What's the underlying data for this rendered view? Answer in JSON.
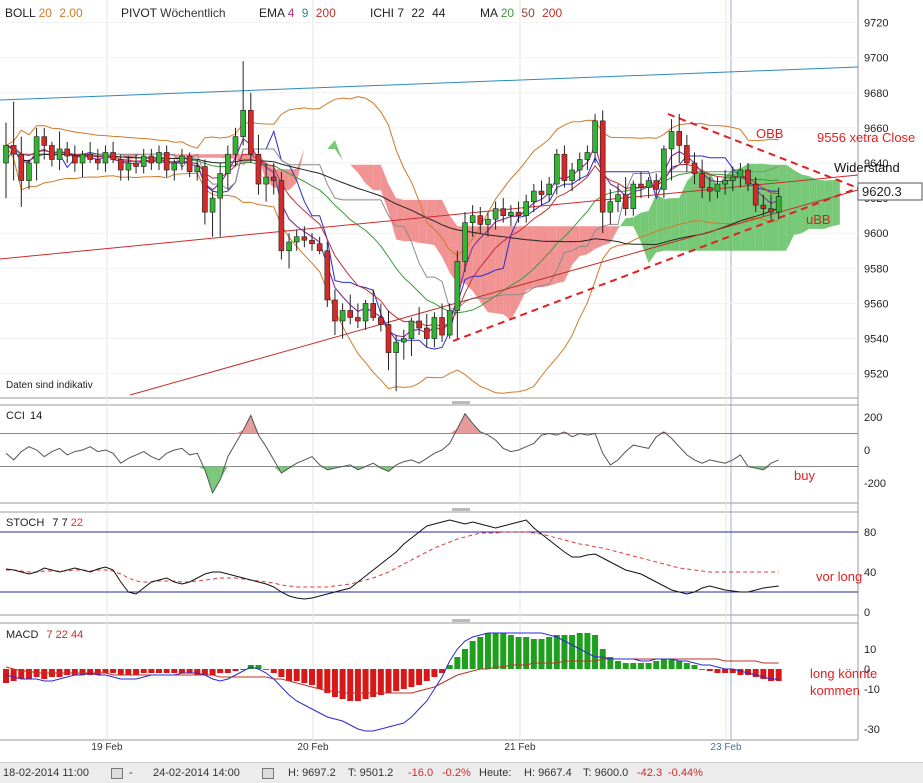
{
  "toolbar": {
    "items": [
      {
        "name": "BOLL",
        "params": [
          {
            "t": "20",
            "c": "#d07a2a"
          },
          {
            "t": "2.00",
            "c": "#d07a2a"
          }
        ]
      },
      {
        "name": "PIVOT",
        "params": [
          {
            "t": "Wöchentlich",
            "c": "#333333"
          }
        ]
      },
      {
        "name": "EMA",
        "params": [
          {
            "t": "4",
            "c": "#b0307f"
          },
          {
            "t": "9",
            "c": "#2a8a8a"
          },
          {
            "t": "200",
            "c": "#c0302a"
          }
        ]
      },
      {
        "name": "ICHI",
        "params": [
          {
            "t": "7",
            "c": "#333333"
          },
          {
            "t": "22",
            "c": "#333333"
          },
          {
            "t": "44",
            "c": "#333333"
          }
        ]
      },
      {
        "name": "MA",
        "params": [
          {
            "t": "20",
            "c": "#3a9a3a"
          },
          {
            "t": "50",
            "c": "#9a4040"
          },
          {
            "t": "200",
            "c": "#c0302a"
          }
        ]
      }
    ]
  },
  "indicators": {
    "cci": {
      "name": "CCI",
      "params": [
        "14"
      ]
    },
    "stoch": {
      "name": "STOCH",
      "params": [
        "7",
        "7",
        "22"
      ]
    },
    "macd": {
      "name": "MACD",
      "params": [
        "7",
        "22",
        "44"
      ]
    }
  },
  "chart_data": {
    "type": "candlestick",
    "disclaimer": "Daten sind indikativ",
    "price_axis": {
      "ticks": [
        9720,
        9700,
        9680,
        9660,
        9640,
        9620,
        9600,
        9580,
        9560,
        9540,
        9520
      ],
      "min": 9505,
      "max": 9730
    },
    "last_price": "9620.3",
    "dates": [
      "19 Feb",
      "20 Feb",
      "21 Feb",
      "23 Feb"
    ],
    "candles": [
      [
        9640,
        9663,
        9620,
        9650
      ],
      [
        9650,
        9675,
        9630,
        9645
      ],
      [
        9645,
        9655,
        9615,
        9630
      ],
      [
        9630,
        9642,
        9625,
        9640
      ],
      [
        9640,
        9660,
        9630,
        9655
      ],
      [
        9655,
        9660,
        9642,
        9650
      ],
      [
        9650,
        9652,
        9638,
        9642
      ],
      [
        9642,
        9658,
        9636,
        9648
      ],
      [
        9648,
        9652,
        9640,
        9644
      ],
      [
        9644,
        9650,
        9635,
        9640
      ],
      [
        9640,
        9647,
        9632,
        9645
      ],
      [
        9645,
        9652,
        9640,
        9642
      ],
      [
        9642,
        9648,
        9636,
        9640
      ],
      [
        9640,
        9650,
        9635,
        9646
      ],
      [
        9646,
        9652,
        9640,
        9642
      ],
      [
        9642,
        9645,
        9630,
        9636
      ],
      [
        9636,
        9644,
        9630,
        9640
      ],
      [
        9640,
        9645,
        9634,
        9638
      ],
      [
        9638,
        9648,
        9634,
        9644
      ],
      [
        9644,
        9648,
        9636,
        9640
      ],
      [
        9640,
        9650,
        9636,
        9646
      ],
      [
        9646,
        9650,
        9632,
        9636
      ],
      [
        9636,
        9642,
        9630,
        9640
      ],
      [
        9640,
        9648,
        9636,
        9644
      ],
      [
        9644,
        9646,
        9632,
        9635
      ],
      [
        9635,
        9642,
        9630,
        9638
      ],
      [
        9638,
        9642,
        9605,
        9612
      ],
      [
        9612,
        9624,
        9598,
        9620
      ],
      [
        9620,
        9640,
        9598,
        9634
      ],
      [
        9634,
        9650,
        9625,
        9645
      ],
      [
        9645,
        9660,
        9638,
        9655
      ],
      [
        9655,
        9698,
        9650,
        9670
      ],
      [
        9670,
        9680,
        9640,
        9645
      ],
      [
        9645,
        9656,
        9622,
        9628
      ],
      [
        9628,
        9640,
        9618,
        9632
      ],
      [
        9632,
        9640,
        9622,
        9630
      ],
      [
        9630,
        9635,
        9585,
        9590
      ],
      [
        9590,
        9600,
        9580,
        9595
      ],
      [
        9595,
        9602,
        9590,
        9598
      ],
      [
        9598,
        9604,
        9592,
        9596
      ],
      [
        9596,
        9600,
        9590,
        9594
      ],
      [
        9594,
        9598,
        9588,
        9590
      ],
      [
        9590,
        9595,
        9558,
        9562
      ],
      [
        9562,
        9568,
        9542,
        9550
      ],
      [
        9550,
        9560,
        9540,
        9556
      ],
      [
        9556,
        9565,
        9548,
        9552
      ],
      [
        9552,
        9560,
        9546,
        9550
      ],
      [
        9550,
        9562,
        9545,
        9560
      ],
      [
        9560,
        9568,
        9550,
        9552
      ],
      [
        9552,
        9560,
        9544,
        9548
      ],
      [
        9548,
        9556,
        9522,
        9532
      ],
      [
        9532,
        9542,
        9510,
        9538
      ],
      [
        9538,
        9545,
        9528,
        9540
      ],
      [
        9540,
        9552,
        9530,
        9550
      ],
      [
        9550,
        9558,
        9542,
        9546
      ],
      [
        9546,
        9554,
        9535,
        9540
      ],
      [
        9540,
        9555,
        9535,
        9552
      ],
      [
        9552,
        9560,
        9538,
        9542
      ],
      [
        9542,
        9560,
        9540,
        9556
      ],
      [
        9556,
        9590,
        9540,
        9584
      ],
      [
        9584,
        9612,
        9578,
        9606
      ],
      [
        9606,
        9616,
        9598,
        9610
      ],
      [
        9610,
        9615,
        9600,
        9605
      ],
      [
        9605,
        9612,
        9598,
        9608
      ],
      [
        9608,
        9618,
        9602,
        9614
      ],
      [
        9614,
        9620,
        9606,
        9610
      ],
      [
        9610,
        9616,
        9604,
        9612
      ],
      [
        9612,
        9618,
        9606,
        9610
      ],
      [
        9610,
        9622,
        9606,
        9618
      ],
      [
        9618,
        9628,
        9612,
        9624
      ],
      [
        9624,
        9630,
        9616,
        9622
      ],
      [
        9622,
        9632,
        9618,
        9628
      ],
      [
        9628,
        9648,
        9622,
        9645
      ],
      [
        9645,
        9650,
        9626,
        9630
      ],
      [
        9630,
        9640,
        9624,
        9636
      ],
      [
        9636,
        9646,
        9630,
        9642
      ],
      [
        9642,
        9650,
        9636,
        9646
      ],
      [
        9646,
        9668,
        9640,
        9664
      ],
      [
        9664,
        9670,
        9600,
        9612
      ],
      [
        9612,
        9625,
        9605,
        9618
      ],
      [
        9618,
        9628,
        9612,
        9622
      ],
      [
        9622,
        9632,
        9610,
        9614
      ],
      [
        9614,
        9630,
        9610,
        9628
      ],
      [
        9628,
        9635,
        9620,
        9626
      ],
      [
        9626,
        9632,
        9620,
        9630
      ],
      [
        9630,
        9634,
        9622,
        9625
      ],
      [
        9625,
        9650,
        9620,
        9648
      ],
      [
        9648,
        9665,
        9630,
        9658
      ],
      [
        9658,
        9668,
        9640,
        9650
      ],
      [
        9650,
        9656,
        9635,
        9640
      ],
      [
        9640,
        9646,
        9628,
        9634
      ],
      [
        9634,
        9642,
        9620,
        9626
      ],
      [
        9626,
        9632,
        9618,
        9624
      ],
      [
        9624,
        9632,
        9620,
        9628
      ],
      [
        9628,
        9636,
        9622,
        9630
      ],
      [
        9630,
        9638,
        9624,
        9632
      ],
      [
        9632,
        9640,
        9626,
        9636
      ],
      [
        9636,
        9640,
        9624,
        9628
      ],
      [
        9628,
        9632,
        9612,
        9616
      ],
      [
        9616,
        9622,
        9610,
        9614
      ],
      [
        9614,
        9622,
        9608,
        9612
      ],
      [
        9612,
        9626,
        9608,
        9621
      ]
    ],
    "annotations": [
      {
        "text": "OBB",
        "color": "#e02020"
      },
      {
        "text": "9556 xetra Close",
        "color": "#e02020"
      },
      {
        "text": "Widerstand",
        "color": "#111111"
      },
      {
        "text": "uBB",
        "color": "#e02020"
      }
    ],
    "cci": {
      "ticks": [
        200,
        0,
        -200
      ],
      "levels": [
        100,
        -100
      ],
      "values": [
        -20,
        -60,
        -10,
        20,
        0,
        -40,
        -10,
        10,
        -30,
        -10,
        0,
        20,
        -10,
        0,
        -20,
        -80,
        -50,
        -30,
        -10,
        -40,
        -60,
        -20,
        0,
        10,
        -30,
        -20,
        -120,
        -260,
        -180,
        -40,
        40,
        120,
        210,
        90,
        20,
        -60,
        -140,
        -110,
        -80,
        -60,
        -40,
        -90,
        -120,
        -110,
        -100,
        -90,
        -120,
        -100,
        -80,
        -110,
        -130,
        -90,
        -70,
        -60,
        -80,
        -50,
        -20,
        0,
        40,
        130,
        220,
        160,
        110,
        90,
        60,
        10,
        -10,
        0,
        20,
        40,
        90,
        100,
        90,
        110,
        80,
        100,
        90,
        100,
        -20,
        -90,
        -60,
        -10,
        30,
        20,
        10,
        80,
        110,
        70,
        20,
        -30,
        -60,
        -80,
        -60,
        -70,
        -80,
        -60,
        -30,
        -100,
        -110,
        -120,
        -80,
        -60
      ]
    },
    "stoch": {
      "ticks": [
        80,
        40,
        0
      ],
      "levels": [
        80,
        20
      ],
      "k": [
        43,
        42,
        40,
        38,
        40,
        44,
        42,
        40,
        42,
        44,
        42,
        40,
        43,
        45,
        42,
        30,
        20,
        18,
        24,
        30,
        32,
        34,
        30,
        28,
        30,
        34,
        38,
        40,
        40,
        38,
        36,
        34,
        32,
        30,
        28,
        25,
        20,
        16,
        14,
        13,
        14,
        16,
        18,
        20,
        22,
        24,
        30,
        36,
        42,
        48,
        54,
        60,
        68,
        74,
        80,
        86,
        88,
        90,
        92,
        90,
        88,
        90,
        88,
        86,
        84,
        86,
        88,
        90,
        92,
        84,
        78,
        72,
        66,
        60,
        55,
        55,
        57,
        58,
        54,
        50,
        46,
        42,
        40,
        38,
        34,
        30,
        26,
        22,
        20,
        18,
        20,
        24,
        26,
        24,
        22,
        21,
        20,
        20,
        22,
        24,
        25,
        26
      ],
      "d": [
        42,
        42,
        41,
        40,
        40,
        41,
        41,
        41,
        41,
        42,
        42,
        41,
        42,
        42,
        41,
        38,
        34,
        31,
        30,
        30,
        31,
        31,
        31,
        30,
        30,
        31,
        32,
        33,
        34,
        34,
        34,
        33,
        32,
        31,
        30,
        29,
        27,
        26,
        25,
        25,
        25,
        25,
        25,
        26,
        27,
        28,
        30,
        32,
        34,
        37,
        40,
        44,
        48,
        52,
        56,
        60,
        64,
        67,
        70,
        73,
        75,
        77,
        79,
        79,
        79,
        80,
        80,
        80,
        80,
        79,
        78,
        76,
        74,
        72,
        70,
        68,
        67,
        65,
        64,
        62,
        60,
        58,
        56,
        54,
        52,
        50,
        48,
        46,
        44,
        43,
        42,
        41,
        40,
        40,
        40,
        40,
        40,
        40,
        40,
        40,
        40,
        40
      ]
    },
    "macd": {
      "ticks": [
        10,
        0,
        -10,
        -30
      ],
      "histogram": [
        -7,
        -6,
        -5,
        -5,
        -4,
        -5,
        -4,
        -4,
        -3,
        -3,
        -3,
        -3,
        -3,
        -2,
        -2,
        -3,
        -3,
        -3,
        -2,
        -2,
        -2,
        -2,
        -2,
        -2,
        -2,
        -3,
        -3,
        -3,
        -2,
        -2,
        -1,
        0,
        2,
        2,
        0,
        -2,
        -4,
        -6,
        -6,
        -7,
        -8,
        -10,
        -12,
        -14,
        -15,
        -16,
        -16,
        -15,
        -14,
        -13,
        -12,
        -11,
        -10,
        -9,
        -8,
        -6,
        -4,
        -2,
        2,
        6,
        10,
        14,
        16,
        18,
        18,
        18,
        17,
        16,
        16,
        15,
        15,
        16,
        17,
        17,
        17,
        18,
        18,
        17,
        10,
        6,
        4,
        3,
        3,
        3,
        3,
        4,
        5,
        5,
        4,
        3,
        2,
        0,
        -1,
        -2,
        -2,
        -2,
        -3,
        -3,
        -4,
        -5,
        -6,
        -6
      ],
      "macd": [
        -3,
        -4,
        -5,
        -5,
        -5,
        -6,
        -6,
        -5,
        -4,
        -3,
        -3,
        -2,
        -3,
        -3,
        -4,
        -5,
        -5,
        -5,
        -4,
        -3,
        -3,
        -3,
        -3,
        -2,
        -2,
        -2,
        -3,
        -5,
        -6,
        -5,
        -3,
        -1,
        1,
        0,
        -2,
        -5,
        -9,
        -13,
        -16,
        -18,
        -20,
        -22,
        -24,
        -25,
        -26,
        -28,
        -30,
        -31,
        -31,
        -30,
        -29,
        -28,
        -27,
        -24,
        -20,
        -16,
        -10,
        -4,
        4,
        10,
        14,
        16,
        17,
        18,
        18,
        18,
        18,
        18,
        18,
        18,
        18,
        17,
        16,
        14,
        12,
        10,
        8,
        6,
        6,
        5,
        5,
        5,
        5,
        4,
        4,
        5,
        5,
        5,
        4,
        4,
        3,
        2,
        2,
        1,
        0,
        0,
        -1,
        -2,
        -3,
        -4,
        -5,
        -5
      ],
      "signal": [
        1,
        0,
        -1,
        -1,
        -2,
        -2,
        -2,
        -2,
        -2,
        -2,
        -2,
        -2,
        -2,
        -2,
        -3,
        -3,
        -3,
        -3,
        -3,
        -3,
        -3,
        -3,
        -3,
        -3,
        -3,
        -3,
        -3,
        -3,
        -4,
        -4,
        -4,
        -4,
        -4,
        -4,
        -4,
        -5,
        -5,
        -6,
        -7,
        -8,
        -9,
        -10,
        -11,
        -11,
        -12,
        -12,
        -12,
        -12,
        -12,
        -12,
        -12,
        -12,
        -12,
        -12,
        -11,
        -10,
        -9,
        -7,
        -5,
        -3,
        -2,
        -1,
        0,
        0,
        1,
        1,
        2,
        2,
        2,
        3,
        3,
        3,
        3,
        4,
        4,
        4,
        4,
        4,
        5,
        5,
        5,
        5,
        5,
        5,
        5,
        5,
        5,
        5,
        5,
        5,
        5,
        5,
        5,
        5,
        4,
        4,
        4,
        4,
        4,
        3,
        3,
        3
      ]
    }
  },
  "side_notes": {
    "cci": "buy",
    "stoch": "vor long",
    "macd_line1": "long könnte",
    "macd_line2": "kommen"
  },
  "footer": {
    "from": "18-02-2014 11:00",
    "to": "24-02-2014 14:00",
    "high_label": "H:",
    "high": "9697.2",
    "low_label": "T:",
    "low": "9501.2",
    "change": "-16.0",
    "change_pct": "-0.2%",
    "today_label": "Heute:",
    "today_high_label": "H:",
    "today_high": "9667.4",
    "today_low_label": "T:",
    "today_low": "9600.0",
    "today_change": "-42.3",
    "today_change_pct": "-0.44%"
  },
  "colors": {
    "up": "#33b533",
    "down": "#d42a2a",
    "cloud_up": "#5fbf5f",
    "cloud_down": "#f08080",
    "cci_pos": "#e69a9a",
    "cci_neg": "#7ac97a"
  }
}
